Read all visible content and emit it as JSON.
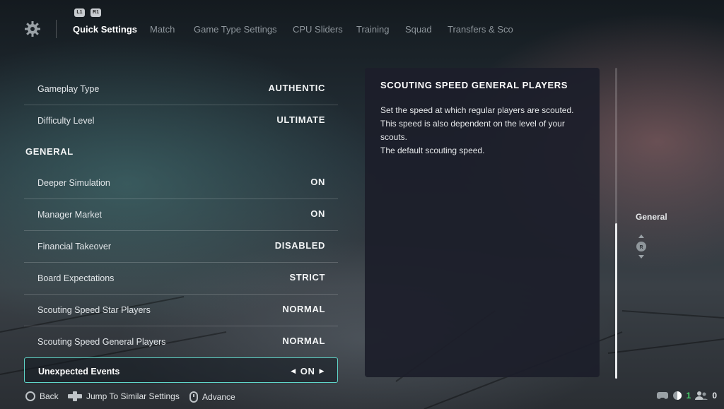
{
  "nav": {
    "bumpers": [
      "L1",
      "R1"
    ],
    "tabs": [
      "Quick Settings",
      "Match",
      "Game Type Settings",
      "CPU Sliders",
      "Training",
      "Squad",
      "Transfers & Sco"
    ],
    "active_tab": "Quick Settings"
  },
  "settings": {
    "rows_top": [
      {
        "label": "Gameplay Type",
        "value": "AUTHENTIC"
      },
      {
        "label": "Difficulty Level",
        "value": "ULTIMATE"
      }
    ],
    "section_title": "GENERAL",
    "rows_general": [
      {
        "label": "Deeper Simulation",
        "value": "ON"
      },
      {
        "label": "Manager Market",
        "value": "ON"
      },
      {
        "label": "Financial Takeover",
        "value": "DISABLED"
      },
      {
        "label": "Board Expectations",
        "value": "STRICT"
      },
      {
        "label": "Scouting Speed Star Players",
        "value": "NORMAL"
      },
      {
        "label": "Scouting Speed General Players",
        "value": "NORMAL"
      }
    ],
    "selected_row": {
      "label": "Unexpected Events",
      "value": "ON",
      "left_arrow": "◀",
      "right_arrow": "▶"
    }
  },
  "panel": {
    "title": "SCOUTING SPEED GENERAL PLAYERS",
    "description": "Set the speed at which regular players are scouted. This speed is also dependent on the level of your scouts.",
    "default_note": "The default scouting speed."
  },
  "scroll": {
    "position_fraction": 0.5
  },
  "side": {
    "jump_label": "General"
  },
  "footer": {
    "back": "Back",
    "jump": "Jump To Similar Settings",
    "advance": "Advance",
    "status_count_1": "1",
    "status_count_2": "0"
  },
  "colors": {
    "accent": "#5fd6c9",
    "panel_bg": "#1c1e2a",
    "online_green": "#47d36b"
  },
  "icons": [
    "gear-icon",
    "circle-button-icon",
    "dpad-icon",
    "touchpad-icon",
    "controller-icon",
    "user-group-icon",
    "right-stick-icon"
  ]
}
